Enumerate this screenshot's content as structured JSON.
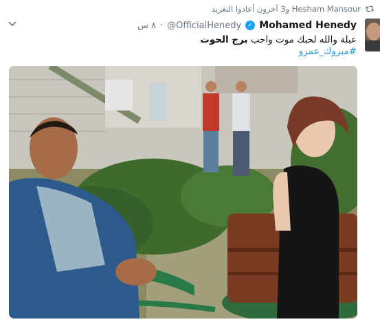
{
  "retweet_context": {
    "text": "Hesham Mansour و3 آخرون أعادوا التغريد",
    "icon": "retweet-icon"
  },
  "author": {
    "display_name": "Mohamed Henedy",
    "verified": true,
    "handle": "@OfficialHenedy",
    "time": "٨ س",
    "avatar_icon": "avatar"
  },
  "tweet": {
    "text_normal": "عبلة والله لحبك موت واحب ",
    "text_bold": "برج الحوت",
    "hashtag": "#مبروك_عمرو"
  },
  "media": {
    "type": "photo"
  },
  "colors": {
    "link": "#1b95e0",
    "verified": "#1da1f2",
    "muted": "#657786"
  }
}
